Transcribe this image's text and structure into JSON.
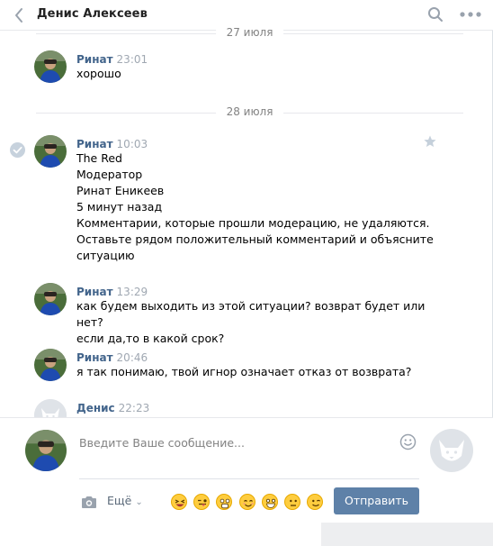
{
  "header": {
    "title": "Денис Алексеев"
  },
  "dates": {
    "first": "27 июля",
    "second": "28 июля"
  },
  "messages": [
    {
      "author": "Ринат",
      "time": "23:01",
      "lines": [
        "хорошо"
      ]
    },
    {
      "author": "Ринат",
      "time": "10:03",
      "lines": [
        "The Red",
        "Модератор",
        "Ринат Еникеев",
        "5 минут назад",
        "Комментарии, которые прошли модерацию, не удаляются.",
        "Оставьте рядом положительный комментарий и объясните",
        "ситуацию"
      ]
    },
    {
      "author": "Ринат",
      "time": "13:29",
      "lines": [
        "как будем выходить из этой ситуации? возврат будет или нет?",
        "если да,то в какой срок?"
      ]
    },
    {
      "author": "Ринат",
      "time": "20:46",
      "lines": [
        "я так понимаю, твой игнор означает отказ от возврата?"
      ]
    },
    {
      "author": "Денис",
      "time": "22:23",
      "lines": []
    }
  ],
  "composer": {
    "placeholder": "Введите Ваше сообщение...",
    "more_label": "Ещё",
    "send_label": "Отправить"
  },
  "icons": {
    "back": "chevron-left-icon",
    "search": "search-icon",
    "more": "more-dots-icon",
    "check": "check-circle-icon",
    "star": "star-icon",
    "smile": "smile-icon",
    "camera": "camera-icon",
    "avatar_placeholder": "dog-avatar-icon"
  },
  "colors": {
    "author": "#42648b",
    "send_button": "#5e81a8",
    "time": "#a0a8b2",
    "emoji": "#fecd3f"
  }
}
